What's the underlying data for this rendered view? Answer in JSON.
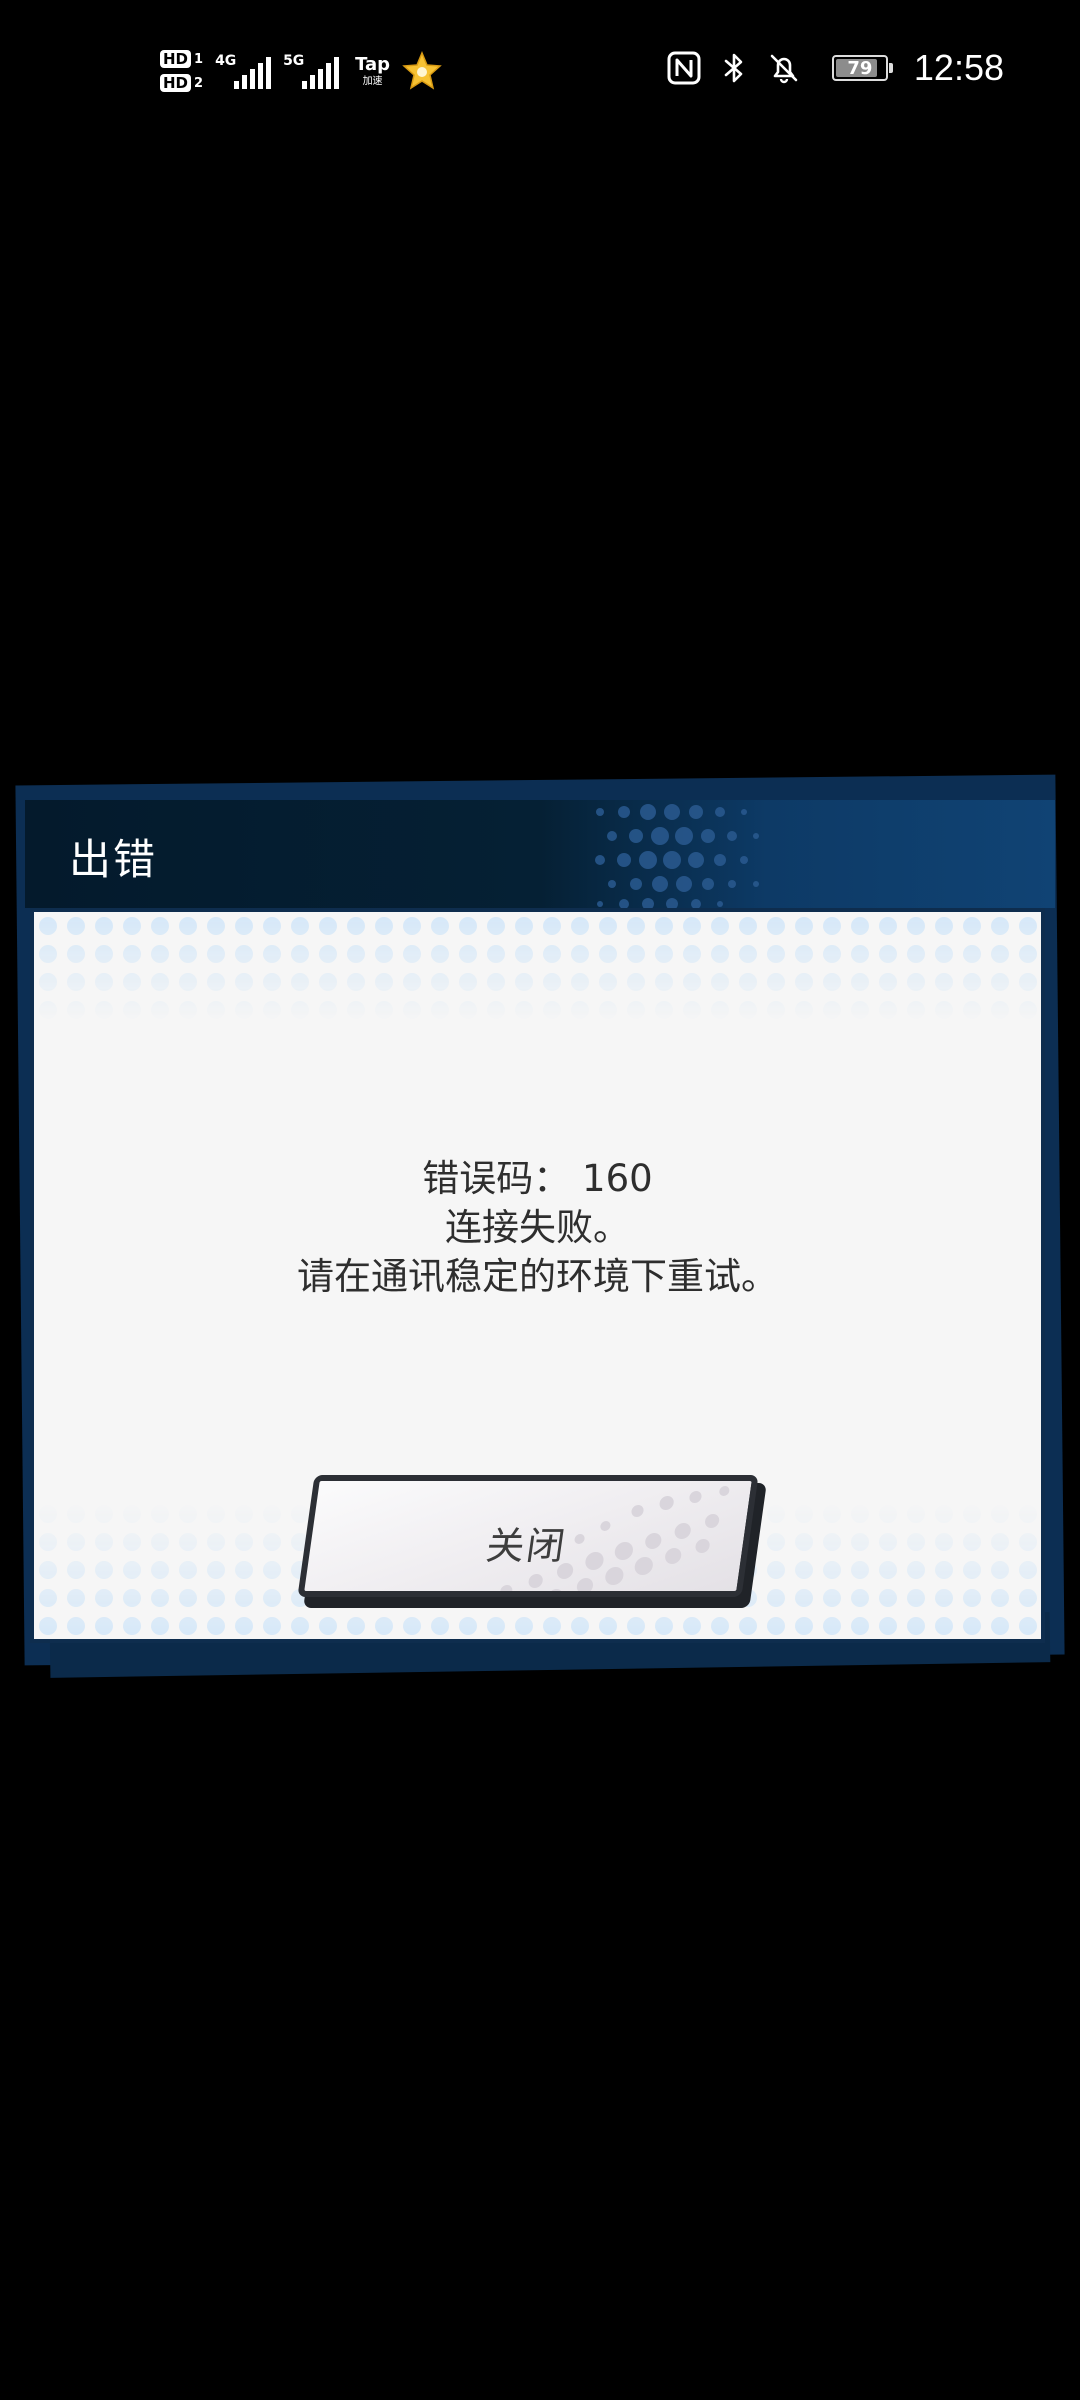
{
  "status_bar": {
    "sim1_label": "HD",
    "sim1_index": "1",
    "sim2_label": "HD",
    "sim2_index": "2",
    "network1": "4G",
    "network2": "5G",
    "tap_label": "Tap",
    "tap_sub": "加速",
    "battery_level": "79",
    "time": "12:58",
    "icons": [
      "nfc-icon",
      "bluetooth-icon",
      "bell-muted-icon",
      "battery-icon",
      "star-badge-icon"
    ]
  },
  "dialog": {
    "title": "出错",
    "message_lines": [
      "错误码： 160",
      "连接失败。",
      "请在通讯稳定的环境下重试。"
    ],
    "close_label": "关闭",
    "colors": {
      "header_dark": "#041a2c",
      "header_accent": "#104374",
      "body_bg": "#f6f6f6",
      "dot_color": "#cfe4f7"
    }
  }
}
